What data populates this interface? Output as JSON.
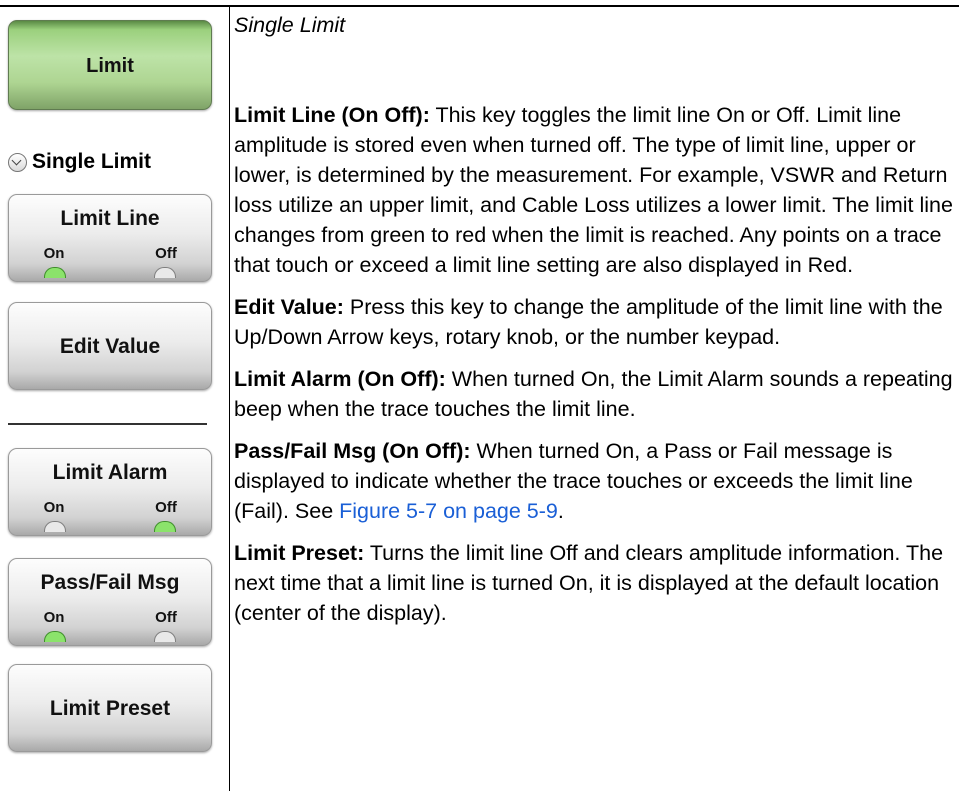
{
  "keys": {
    "limit": {
      "label": "Limit"
    },
    "section": {
      "title": "Single Limit"
    },
    "limit_line": {
      "label": "Limit Line",
      "on": "On",
      "off": "Off",
      "state": "On"
    },
    "edit_value": {
      "label": "Edit Value"
    },
    "limit_alarm": {
      "label": "Limit Alarm",
      "on": "On",
      "off": "Off",
      "state": "Off"
    },
    "pass_fail": {
      "label": "Pass/Fail Msg",
      "on": "On",
      "off": "Off",
      "state": "On"
    },
    "limit_preset": {
      "label": "Limit Preset"
    }
  },
  "doc": {
    "heading": "Single Limit",
    "p1_term": "Limit Line (On  Off):",
    "p1_text": " This key toggles the limit line On or Off. Limit line amplitude is stored even when turned off. The type of limit line, upper or lower, is determined by the measurement. For example, VSWR and Return loss utilize an upper limit, and Cable Loss utilizes a lower limit. The limit line changes from green to red when the limit is reached. Any points on a trace that touch or exceed a limit line setting are also displayed in Red.",
    "p2_term": "Edit Value:",
    "p2_text": " Press this key to change the amplitude of the limit line with the Up/Down Arrow keys, rotary knob, or the number keypad.",
    "p3_term": "Limit Alarm (On  Off):",
    "p3_text": " When turned On, the Limit Alarm sounds a repeating beep when the trace touches the limit line.",
    "p4_term": "Pass/Fail Msg (On  Off):",
    "p4_text": " When turned On, a Pass or Fail message is displayed to indicate whether the trace touches or exceeds the limit line (Fail). See ",
    "p4_link": "Figure 5-7 on page 5-9",
    "p4_end": ".",
    "p5_term": "Limit Preset:",
    "p5_text": " Turns the limit line Off and clears amplitude information. The next time that a limit line is turned On, it is displayed at the default location (center of the display)."
  },
  "colors": {
    "active_led": "#8be36b",
    "active_key": "#a9d990",
    "link": "#1a5fd6"
  }
}
